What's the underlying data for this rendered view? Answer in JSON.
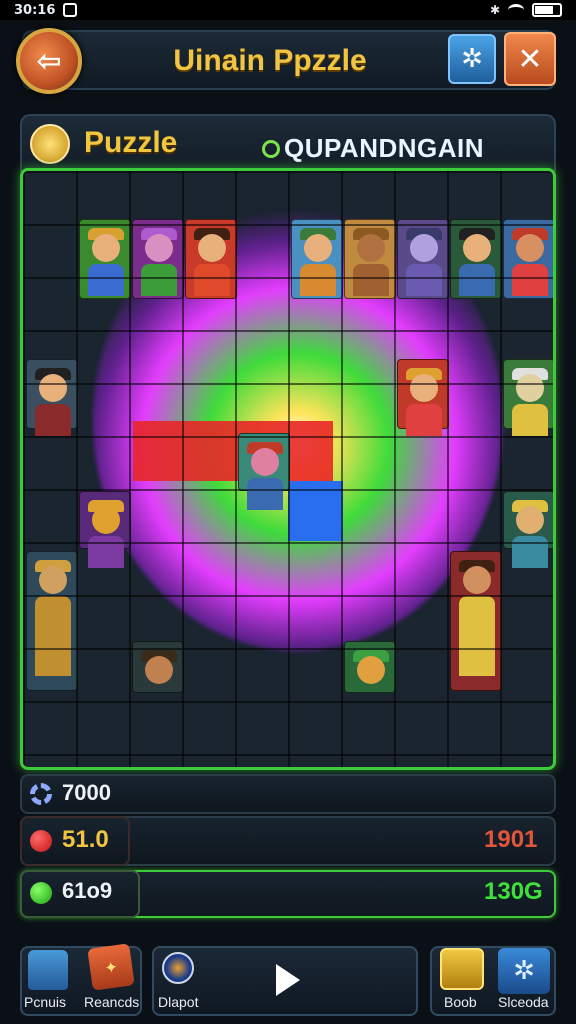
{
  "status_bar": {
    "time": "30:16"
  },
  "header": {
    "title": "Uinain Ppzzle"
  },
  "panel": {
    "label": "Puzzle",
    "mode": "QUPANDNGAIN"
  },
  "stats": {
    "row1": {
      "value": "7000"
    },
    "row2": {
      "left": "51.0",
      "right": "1901"
    },
    "row3": {
      "left": "61o9",
      "right": "130G"
    }
  },
  "nav": {
    "item1": "Pcnuis",
    "item2": "Reancds",
    "item3": "Dlapot",
    "item4": "Boob",
    "item5": "Slceoda"
  },
  "colors": {
    "accent_gold": "#f1c542",
    "board_border": "#3ecb3a",
    "red_value": "#e23b3b",
    "green_value": "#3ee13a",
    "stat_right_red": "#e2553b"
  },
  "icons": [
    "back-arrow-icon",
    "settings-gear-icon",
    "close-x-icon",
    "puzzle-badge-icon",
    "gear-icon",
    "red-dot-icon",
    "green-dot-icon",
    "home-icon",
    "gift-icon",
    "map-pin-icon",
    "play-icon",
    "dice-icon",
    "settings-icon"
  ]
}
